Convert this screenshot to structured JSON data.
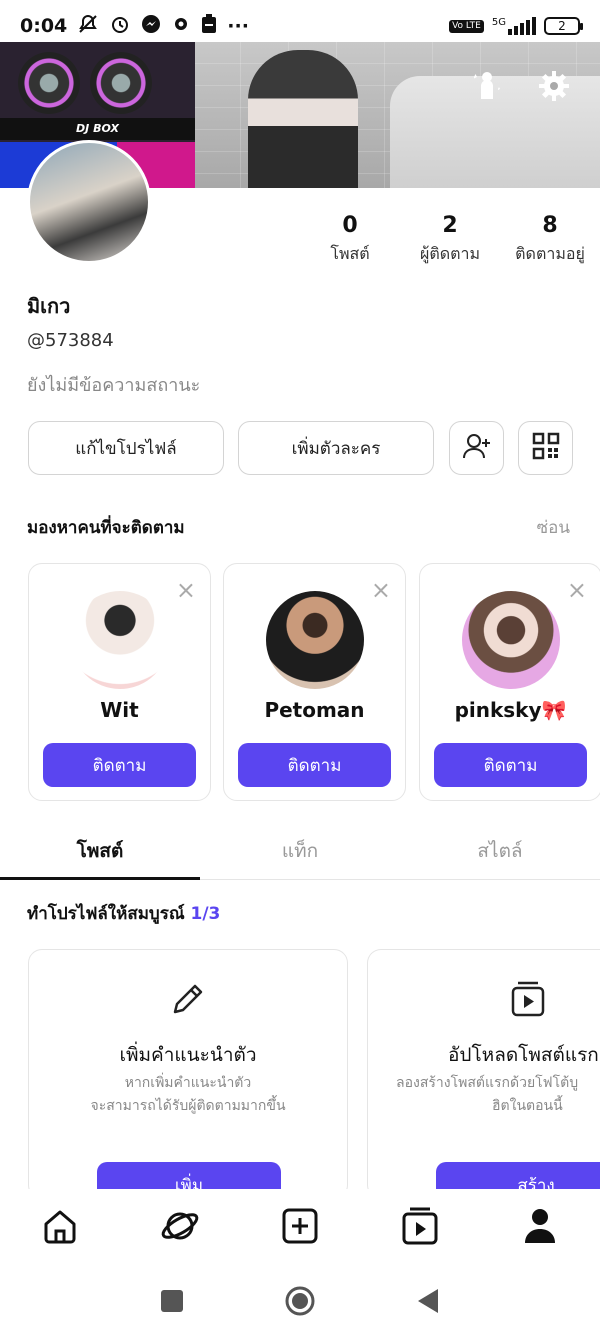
{
  "status_bar": {
    "time": "0:04",
    "sim_label": "Vo LTE",
    "network": "5G",
    "battery_level": "2"
  },
  "cover": {
    "dj_label": "DJ BOX"
  },
  "profile": {
    "stats": [
      {
        "value": "0",
        "label": "โพสต์"
      },
      {
        "value": "2",
        "label": "ผู้ติดตาม"
      },
      {
        "value": "8",
        "label": "ติดตามอยู่"
      }
    ],
    "name": "มิเกว",
    "handle": "@573884",
    "status": "ยังไม่มีข้อความสถานะ"
  },
  "actions": {
    "edit_profile": "แก้ไขโปรไฟล์",
    "add_character": "เพิ่มตัวละคร"
  },
  "suggestions": {
    "title": "มองหาคนที่จะติดตาม",
    "hide": "ซ่อน",
    "cards": [
      {
        "name": "Wit",
        "button": "ติดตาม"
      },
      {
        "name": "Petoman",
        "button": "ติดตาม"
      },
      {
        "name": "pinksky🎀",
        "button": "ติดตาม"
      }
    ]
  },
  "tabs": [
    "โพสต์",
    "แท็ก",
    "สไตล์"
  ],
  "complete_profile": {
    "title": "ทำโปรไฟล์ให้สมบูรณ์",
    "progress": "1/3",
    "tasks": [
      {
        "icon": "pencil-icon",
        "title": "เพิ่มคำแนะนำตัว",
        "desc_line1": "หากเพิ่มคำแนะนำตัว",
        "desc_line2": "จะสามารถได้รับผู้ติดตามมากขึ้น",
        "button": "เพิ่ม"
      },
      {
        "icon": "video-upload-icon",
        "title": "อัปโหลดโพสต์แรก",
        "desc_line1": "ลองสร้างโพสต์แรกด้วยโฟโต้บู",
        "desc_line2": "ฮิตในตอนนี้",
        "button": "สร้าง"
      }
    ]
  },
  "bottom_nav": [
    "home-icon",
    "explore-planet-icon",
    "create-plus-icon",
    "video-feed-icon",
    "profile-icon"
  ],
  "colors": {
    "accent": "#5a45f0"
  }
}
